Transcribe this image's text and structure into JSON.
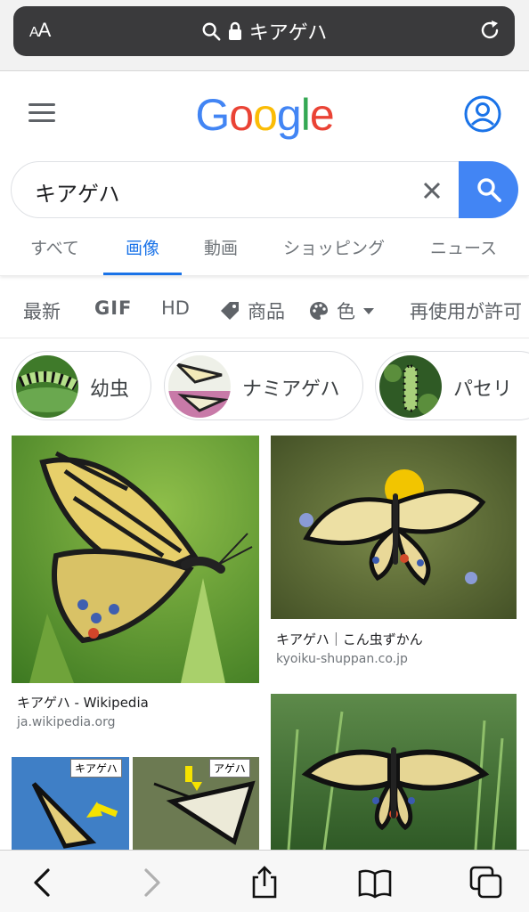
{
  "browser": {
    "aa_label_small": "A",
    "aa_label": "A",
    "url_text": "キアゲハ"
  },
  "google": {
    "logo_letters": [
      "G",
      "o",
      "o",
      "g",
      "l",
      "e"
    ],
    "logo_colors": [
      "#4285F4",
      "#EA4335",
      "#FBBC05",
      "#4285F4",
      "#34A853",
      "#EA4335"
    ]
  },
  "search": {
    "query": "キアゲハ"
  },
  "tabs": [
    {
      "label": "すべて"
    },
    {
      "label": "画像",
      "active": true
    },
    {
      "label": "動画"
    },
    {
      "label": "ショッピング"
    },
    {
      "label": "ニュース"
    }
  ],
  "filters": {
    "latest": "最新",
    "gif": "GIF",
    "hd": "HD",
    "products": "商品",
    "color": "色",
    "reuse": "再使用が許可"
  },
  "chips": [
    {
      "label": "幼虫"
    },
    {
      "label": "ナミアゲハ"
    },
    {
      "label": "パセリ"
    }
  ],
  "results": [
    {
      "title": "キアゲハ - Wikipedia",
      "site": "ja.wikipedia.org"
    },
    {
      "title": "キアゲハ｜こん虫ずかん",
      "site": "kyoiku-shuppan.co.jp"
    },
    {
      "label_left": "キアゲハ",
      "label_right": "アゲハ"
    },
    {}
  ],
  "colors": {
    "accent": "#1a73e8",
    "search_button": "#4285f4"
  }
}
